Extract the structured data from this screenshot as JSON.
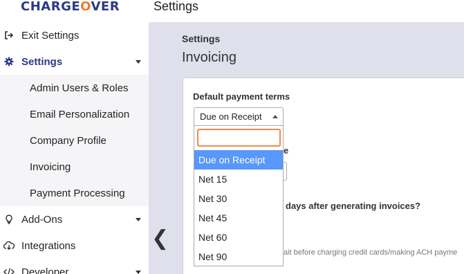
{
  "brand": {
    "logo_prefix": "CHARGE",
    "logo_o": "O",
    "logo_suffix": "VER"
  },
  "header": {
    "title": "Settings"
  },
  "sidebar": {
    "items": [
      {
        "label": "Exit Settings",
        "icon": "sign-out-icon"
      },
      {
        "label": "Settings",
        "icon": "gear-icon",
        "active": true
      },
      {
        "label": "Admin Users & Roles"
      },
      {
        "label": "Email Personalization"
      },
      {
        "label": "Company Profile"
      },
      {
        "label": "Invoicing"
      },
      {
        "label": "Payment Processing"
      },
      {
        "label": "Add-Ons",
        "icon": "lightbulb-icon"
      },
      {
        "label": "Integrations",
        "icon": "cloud-download-icon"
      },
      {
        "label": "Developer",
        "icon": "code-icon"
      }
    ]
  },
  "main": {
    "breadcrumb": "Settings",
    "title": "Invoicing",
    "payment_terms": {
      "label": "Default payment terms",
      "selected": "Due on Receipt",
      "search_value": "",
      "options": [
        "Due on Receipt",
        "Net 15",
        "Net 30",
        "Net 45",
        "Net 60",
        "Net 90"
      ]
    },
    "partial_texts": {
      "label_fragment": "e",
      "days_question": "days after generating invoices?",
      "wait_hint": "ait before charging credit cards/making ACH payme"
    }
  },
  "colors": {
    "brand_blue": "#2b3a86",
    "brand_orange": "#f07a2a",
    "highlight": "#5897fb",
    "focus": "#f08a4b",
    "main_bg": "#dfe0ec"
  }
}
